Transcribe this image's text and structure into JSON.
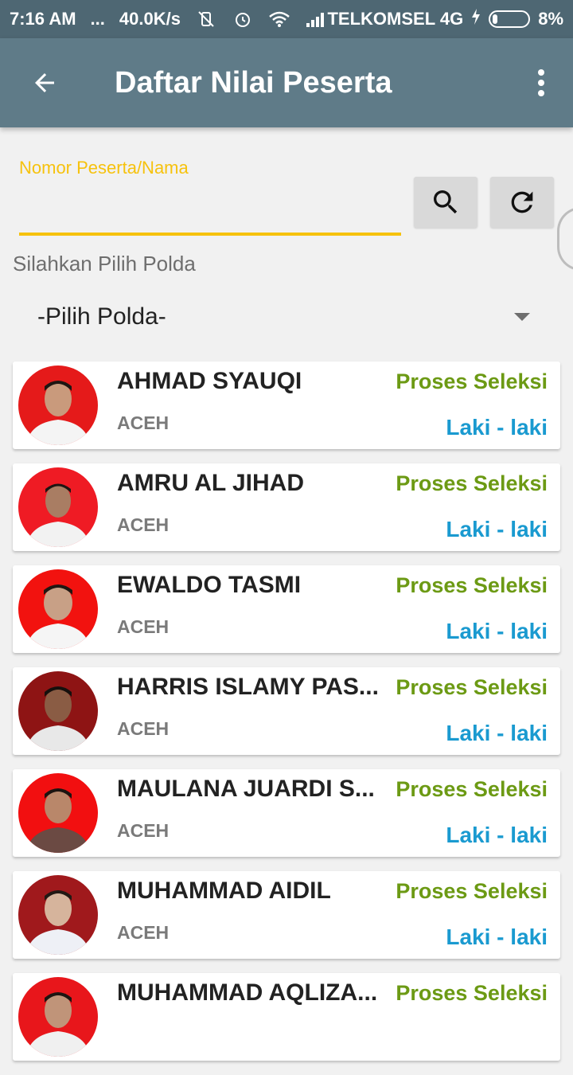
{
  "status_bar": {
    "time": "7:16 AM",
    "dots": "...",
    "speed": "40.0K/s",
    "carrier": "TELKOMSEL 4G",
    "battery": "8%"
  },
  "app_bar": {
    "title": "Daftar Nilai Peserta"
  },
  "search": {
    "label": "Nomor Peserta/Nama",
    "value": ""
  },
  "polda": {
    "label": "Silahkan Pilih Polda",
    "selected": "-Pilih Polda-"
  },
  "participants": [
    {
      "name": "AHMAD SYAUQI",
      "region": "ACEH",
      "status": "Proses Seleksi",
      "gender": "Laki - laki"
    },
    {
      "name": "AMRU AL JIHAD",
      "region": "ACEH",
      "status": "Proses Seleksi",
      "gender": "Laki - laki"
    },
    {
      "name": "EWALDO TASMI",
      "region": "ACEH",
      "status": "Proses Seleksi",
      "gender": "Laki - laki"
    },
    {
      "name": "HARRIS ISLAMY PAS...",
      "region": "ACEH",
      "status": "Proses Seleksi",
      "gender": "Laki - laki"
    },
    {
      "name": "MAULANA JUARDI S...",
      "region": "ACEH",
      "status": "Proses Seleksi",
      "gender": "Laki - laki"
    },
    {
      "name": "MUHAMMAD AIDIL",
      "region": "ACEH",
      "status": "Proses Seleksi",
      "gender": "Laki - laki"
    },
    {
      "name": "MUHAMMAD AQLIZA...",
      "region": "",
      "status": "Proses Seleksi",
      "gender": ""
    }
  ],
  "colors": {
    "status_bar": "#4e6773",
    "app_bar": "#5f7b88",
    "accent_yellow": "#f6c20d",
    "status_green": "#6c9a14",
    "gender_blue": "#1a9ad0"
  }
}
